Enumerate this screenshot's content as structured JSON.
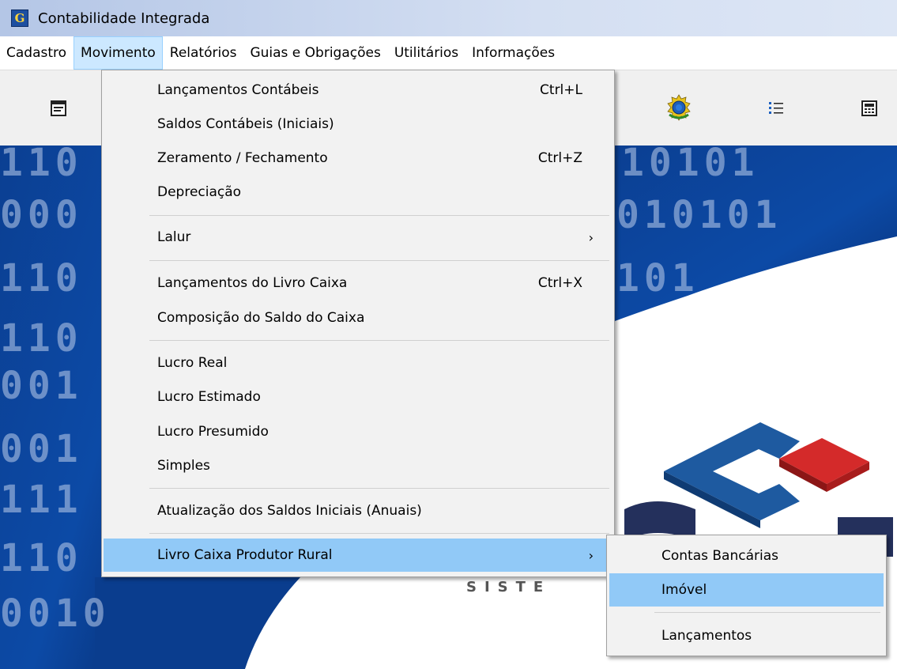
{
  "window": {
    "title": "Contabilidade Integrada",
    "icon": "app-g-icon"
  },
  "menubar": {
    "items": [
      {
        "label": "Cadastro"
      },
      {
        "label": "Movimento",
        "active": true
      },
      {
        "label": "Relatórios"
      },
      {
        "label": "Guias e Obrigações"
      },
      {
        "label": "Utilitários"
      },
      {
        "label": "Informações"
      }
    ]
  },
  "toolbar": {
    "icons": [
      "form-icon",
      "brazil-coat-of-arms-icon",
      "numbered-list-icon",
      "calculator-icon"
    ]
  },
  "movimento_menu": {
    "items": [
      {
        "label": "Lançamentos Contábeis",
        "shortcut": "Ctrl+L"
      },
      {
        "label": "Saldos Contábeis (Iniciais)",
        "shortcut": ""
      },
      {
        "label": "Zeramento / Fechamento",
        "shortcut": "Ctrl+Z"
      },
      {
        "label": "Depreciação",
        "shortcut": ""
      },
      {
        "label": "Lalur",
        "shortcut": "",
        "submenu": true
      },
      {
        "label": "Lançamentos do Livro Caixa",
        "shortcut": "Ctrl+X"
      },
      {
        "label": "Composição do Saldo do Caixa",
        "shortcut": ""
      },
      {
        "label": "Lucro Real",
        "shortcut": ""
      },
      {
        "label": "Lucro Estimado",
        "shortcut": ""
      },
      {
        "label": "Lucro Presumido",
        "shortcut": ""
      },
      {
        "label": "Simples",
        "shortcut": ""
      },
      {
        "label": "Atualização dos Saldos Iniciais (Anuais)",
        "shortcut": ""
      },
      {
        "label": "Livro Caixa Produtor Rural",
        "shortcut": "",
        "submenu": true,
        "highlighted": true
      }
    ],
    "submenu_arrow": "›"
  },
  "produtor_rural_submenu": {
    "items": [
      {
        "label": "Contas Bancárias"
      },
      {
        "label": "Imóvel",
        "highlighted": true
      },
      {
        "label": "Lançamentos"
      }
    ]
  },
  "background": {
    "binary_rows": [
      "110",
      "000",
      "110",
      "110",
      "001",
      "001",
      "111",
      "110",
      "0010"
    ],
    "binary_rows_right": [
      "10101",
      "010101",
      "101"
    ],
    "logo_text": "SISTE"
  },
  "colors": {
    "menu_highlight": "#91c9f7",
    "menubar_active": "#cce8ff",
    "background_blue": "#0a3a8c",
    "logo_blue": "#1e5aa0",
    "logo_red": "#d42a2a"
  }
}
